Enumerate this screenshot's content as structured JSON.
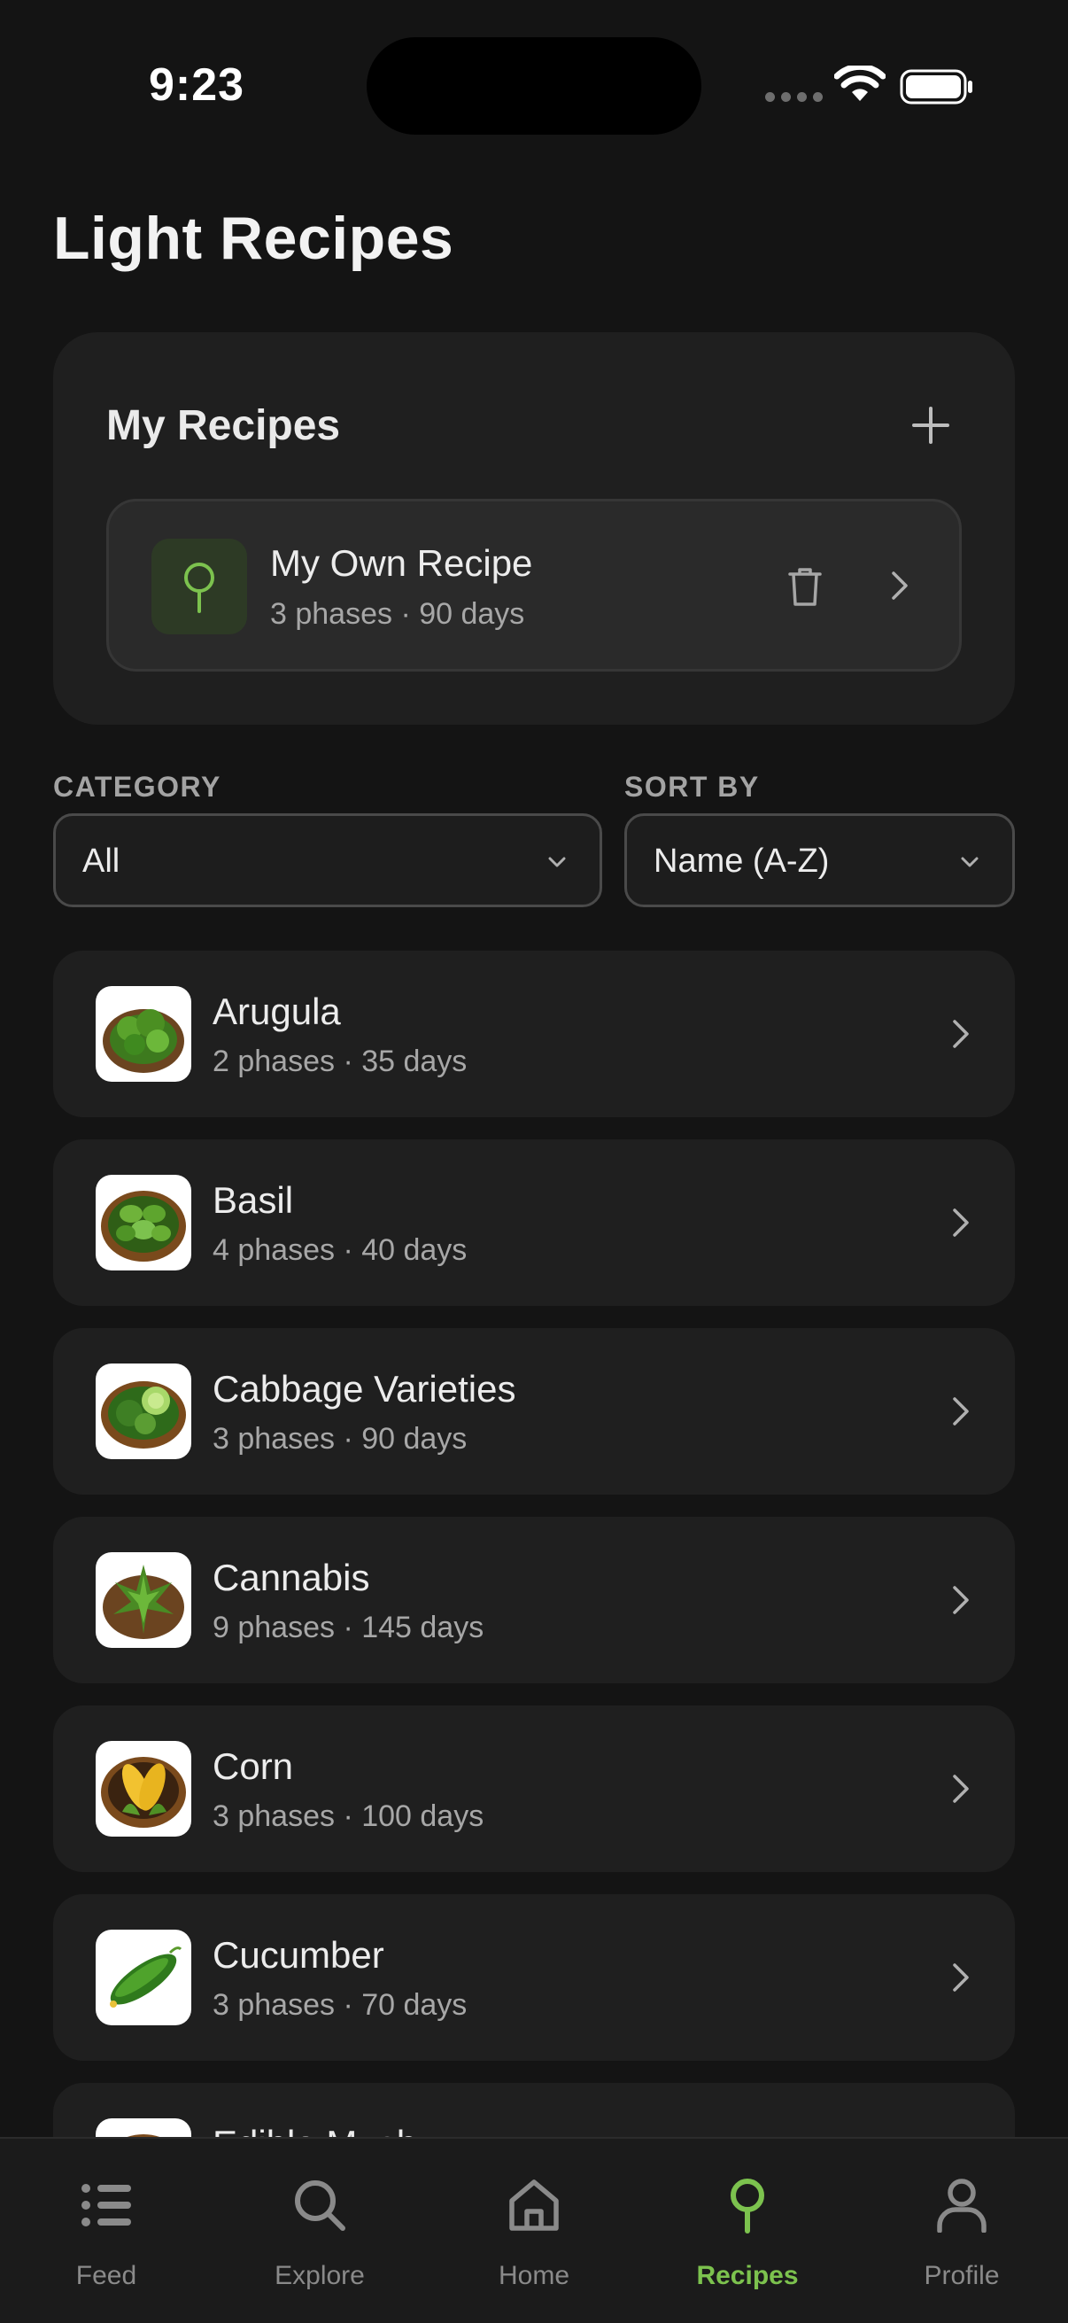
{
  "status_bar": {
    "time": "9:23"
  },
  "page": {
    "title": "Light Recipes"
  },
  "my_recipes": {
    "title": "My Recipes",
    "add_icon": "plus-icon",
    "items": [
      {
        "name": "My Own Recipe",
        "subtitle": "3 phases · 90 days",
        "icon": "sprout-icon"
      }
    ]
  },
  "filters": {
    "category_label": "CATEGORY",
    "category_value": "All",
    "sort_label": "SORT BY",
    "sort_value": "Name (A-Z)"
  },
  "recipes": [
    {
      "name": "Arugula",
      "subtitle": "2 phases · 35 days",
      "image": "arugula"
    },
    {
      "name": "Basil",
      "subtitle": "4 phases · 40 days",
      "image": "basil"
    },
    {
      "name": "Cabbage Varieties",
      "subtitle": "3 phases · 90 days",
      "image": "cabbage"
    },
    {
      "name": "Cannabis",
      "subtitle": "9 phases · 145 days",
      "image": "cannabis"
    },
    {
      "name": "Corn",
      "subtitle": "3 phases · 100 days",
      "image": "corn"
    },
    {
      "name": "Cucumber",
      "subtitle": "3 phases · 70 days",
      "image": "cucumber"
    },
    {
      "name": "Edible Mush...",
      "subtitle": "",
      "image": "mushroom"
    }
  ],
  "nav": {
    "items": [
      {
        "label": "Feed",
        "icon": "list-icon",
        "active": false
      },
      {
        "label": "Explore",
        "icon": "search-icon",
        "active": false
      },
      {
        "label": "Home",
        "icon": "home-icon",
        "active": false
      },
      {
        "label": "Recipes",
        "icon": "sprout-icon",
        "active": true
      },
      {
        "label": "Profile",
        "icon": "person-icon",
        "active": false
      }
    ]
  },
  "colors": {
    "background": "#141414",
    "card": "#1f1f1f",
    "accent": "#7cc24e",
    "text": "#ececec",
    "muted": "#a7a7a7"
  }
}
